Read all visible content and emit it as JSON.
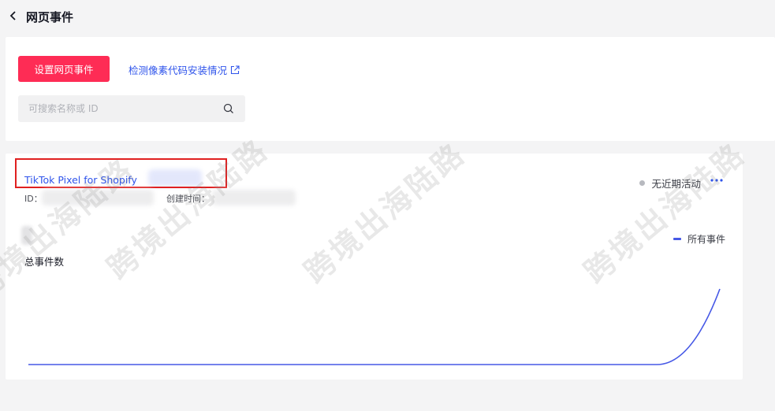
{
  "header": {
    "title": "网页事件"
  },
  "toolbar": {
    "setup_button": "设置网页事件",
    "detect_link": "检测像素代码安装情况",
    "search_placeholder": "可搜索名称或 ID"
  },
  "pixel": {
    "name": "TikTok Pixel for Shopify",
    "id_label": "ID：",
    "created_label": "创建时间：",
    "status": "无近期活动"
  },
  "chart_data": {
    "type": "line",
    "ylabel": "总事件数",
    "series": [
      {
        "name": "所有事件",
        "values": [
          0,
          0,
          0,
          0,
          0,
          0,
          0,
          0,
          0,
          0,
          0,
          1
        ]
      }
    ],
    "grid": false,
    "legend": "top-right"
  },
  "watermark": {
    "text": "跨境出海陆路"
  },
  "colors": {
    "accent": "#fe2c55",
    "link": "#2f54eb",
    "series": "#4658e6"
  }
}
